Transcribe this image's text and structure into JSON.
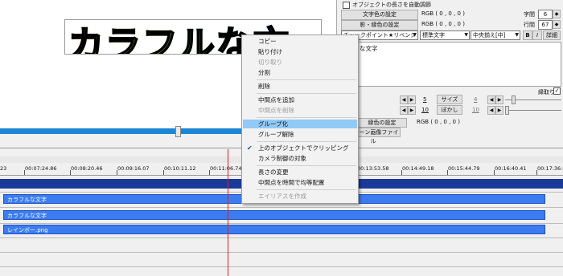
{
  "preview": {
    "banner_text": "カラフルな文"
  },
  "panel": {
    "auto_length_label": "オブジェクトの長さを自動調節",
    "text_color_button": "文字色の設定",
    "text_color_value": "RGB ( 0 , 0 , 0 )",
    "shadow_color_button": "影・縁色の設定",
    "shadow_color_value": "RGB ( 0 , 0 , 0 )",
    "char_spacing_label": "字間",
    "char_spacing_value": "6",
    "line_spacing_label": "行間",
    "line_spacing_value": "67",
    "bold_button": "B",
    "italic_button": "I",
    "detail_button": "詳細",
    "font_select": "チャックポイント★リベンジ",
    "style_select": "標準文字",
    "align_select": "中央揃え[中]",
    "text_content": "な文字",
    "border_label": "縁取り",
    "slider1_value": "5",
    "slider1_button": "サイズ",
    "slider1_right_value": "4",
    "slider2_value": "10",
    "slider2_button": "ぼかし",
    "slider2_right_value": "10",
    "edge_color_button": "縁色の設定",
    "edge_color_value": "RGB ( 0 , 0 , 0 )",
    "pattern_button": "パターン画像ファイル"
  },
  "timeline": {
    "ticks": [
      "23",
      "00:07:24.86",
      "00:08:20.46",
      "00:09:16.07",
      "00:10:11.12",
      "00:11:06.74",
      "00:13:53.58",
      "00:14:49.18",
      "00:15:44.79",
      "00:16:40.41",
      "00:17:36.0"
    ],
    "clips": [
      "カラフルな文字",
      "カラフルな文字",
      "レインボー.png"
    ]
  },
  "menu": {
    "items": [
      {
        "label": "コピー",
        "disabled": false
      },
      {
        "label": "貼り付け",
        "disabled": false
      },
      {
        "label": "切り取り",
        "disabled": true
      },
      {
        "label": "分割",
        "disabled": false
      },
      {
        "label": "削除",
        "disabled": false
      },
      {
        "label": "中間点を追加",
        "disabled": false
      },
      {
        "label": "中間点を削除",
        "disabled": true
      },
      {
        "label": "グループ化",
        "disabled": false,
        "highlighted": true
      },
      {
        "label": "グループ解除",
        "disabled": false
      },
      {
        "label": "上のオブジェクトでクリッピング",
        "disabled": false,
        "checked": true
      },
      {
        "label": "カメラ制御の対象",
        "disabled": false
      },
      {
        "label": "長さの変更",
        "disabled": false
      },
      {
        "label": "中間点を時間で均等配置",
        "disabled": false
      },
      {
        "label": "エイリアスを作成",
        "disabled": true
      }
    ]
  },
  "colors": {
    "accent": "#1c86d6",
    "clip": "#3b7cf0",
    "scene": "#1a3a9a",
    "highlight": "#91c9f7",
    "cursor": "#e02020"
  }
}
